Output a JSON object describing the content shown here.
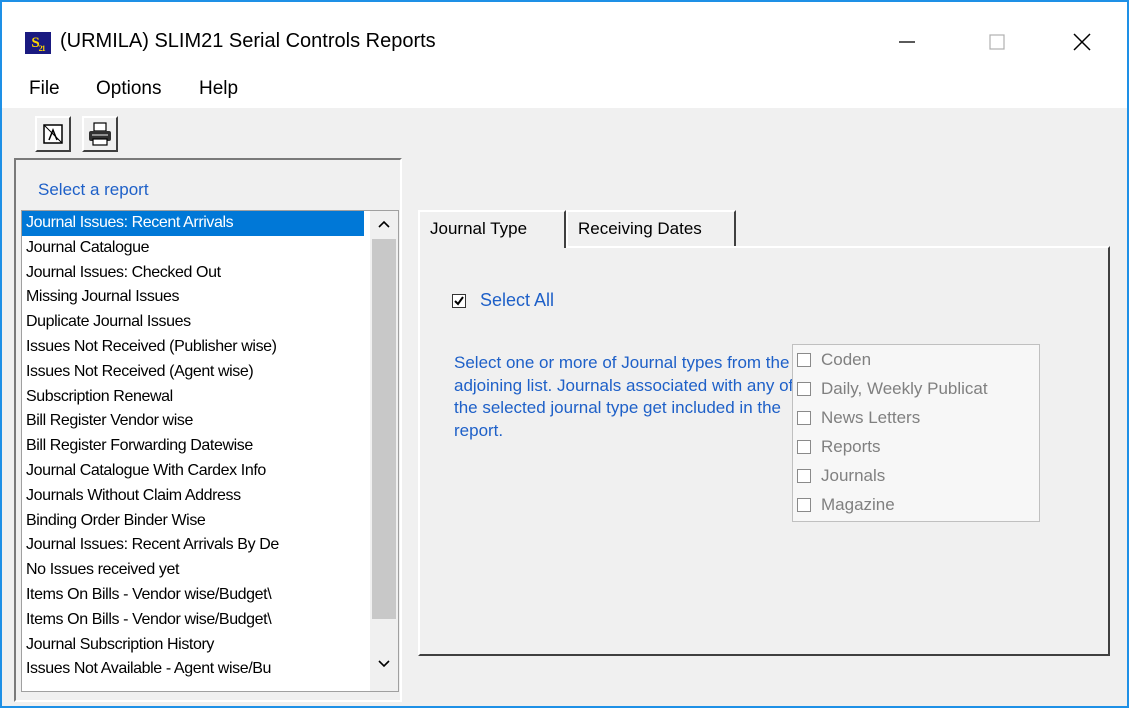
{
  "window": {
    "title": "(URMILA) SLIM21 Serial Controls Reports",
    "icon_text": "S21",
    "controls": [
      "minimize-icon",
      "maximize-icon",
      "close-icon"
    ]
  },
  "menu": {
    "items": [
      {
        "label": "File"
      },
      {
        "label": "Options"
      },
      {
        "label": "Help"
      }
    ]
  },
  "toolbar": {
    "buttons": [
      {
        "icon": "preview-icon"
      },
      {
        "icon": "printer-icon"
      }
    ]
  },
  "report_panel": {
    "title": "Select a report",
    "selected_index": 0,
    "items": [
      "Journal Issues: Recent Arrivals",
      "Journal Catalogue",
      "Journal Issues: Checked Out",
      "Missing Journal Issues",
      "Duplicate Journal Issues",
      "Issues Not Received (Publisher wise)",
      "Issues Not Received (Agent wise)",
      "Subscription Renewal",
      "Bill Register Vendor wise",
      "Bill Register Forwarding Datewise",
      "Journal Catalogue With Cardex Info",
      "Journals Without Claim Address",
      "Binding Order Binder Wise",
      "Journal Issues: Recent Arrivals By De",
      "No Issues received yet",
      "Items On Bills -  Vendor wise/Budget\\",
      "Items On Bills -  Vendor wise/Budget\\",
      "Journal Subscription History",
      "Issues Not Available - Agent wise/Bu"
    ]
  },
  "tabs": [
    {
      "label": "Journal Type",
      "active": true
    },
    {
      "label": "Receiving Dates",
      "active": false
    }
  ],
  "journal_type_tab": {
    "select_all_label": "Select All",
    "select_all_checked": true,
    "description": "Select one or more of Journal types from the adjoining list. Journals associated with any of the selected journal type get included in the report.",
    "journal_types": [
      {
        "label": "Coden",
        "checked": false
      },
      {
        "label": "Daily, Weekly Publicat",
        "checked": false
      },
      {
        "label": "News Letters",
        "checked": false
      },
      {
        "label": "Reports",
        "checked": false
      },
      {
        "label": "Journals",
        "checked": false
      },
      {
        "label": "Magazine",
        "checked": false
      }
    ]
  },
  "colors": {
    "accent_text": "#1e60c8",
    "selection": "#0078d7",
    "window_border": "#1e90e6"
  }
}
